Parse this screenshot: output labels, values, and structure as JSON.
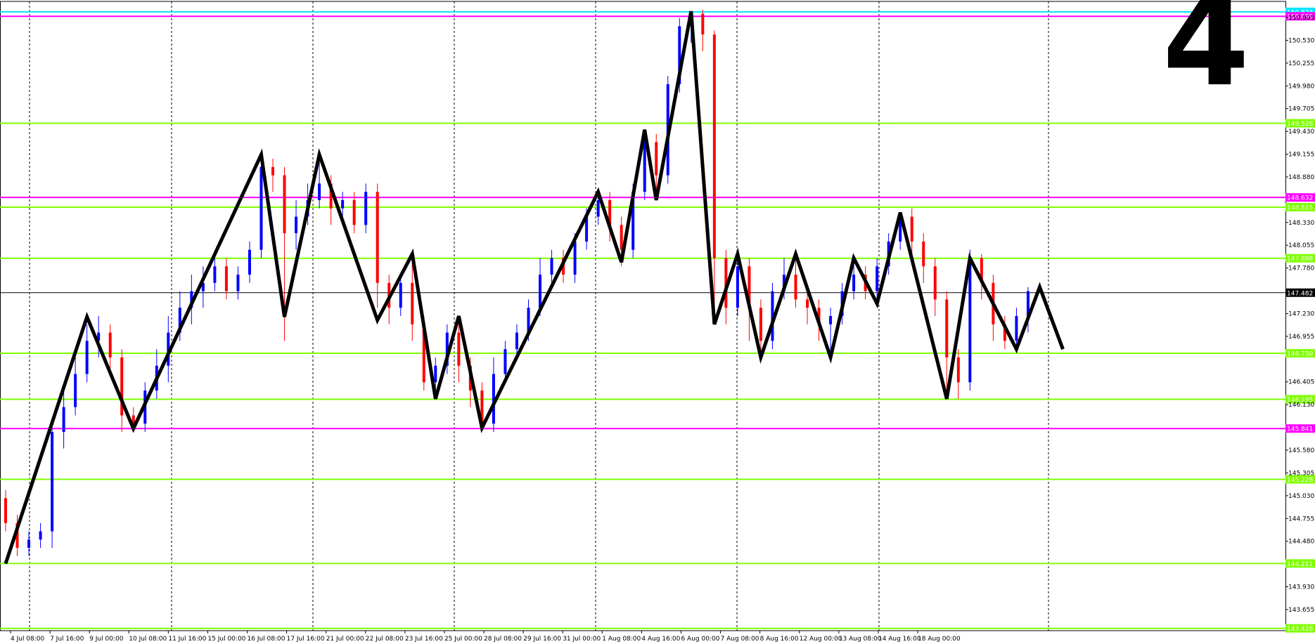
{
  "chart_data": {
    "type": "candlestick",
    "corner_label": "4",
    "ylim": [
      143.4,
      151.0
    ],
    "y_ticks": [
      "150.805",
      "150.530",
      "150.255",
      "149.980",
      "149.705",
      "149.430",
      "149.155",
      "148.880",
      "148.330",
      "148.055",
      "147.780",
      "147.230",
      "146.955",
      "146.405",
      "146.130",
      "145.580",
      "145.305",
      "145.030",
      "144.755",
      "144.480",
      "143.930",
      "143.655"
    ],
    "x_labels": [
      "4 Jul 08:00",
      "7 Jul 16:00",
      "9 Jul 00:00",
      "10 Jul 08:00",
      "11 Jul 16:00",
      "15 Jul 00:00",
      "16 Jul 08:00",
      "17 Jul 16:00",
      "21 Jul 00:00",
      "22 Jul 08:00",
      "23 Jul 16:00",
      "25 Jul 00:00",
      "28 Jul 08:00",
      "29 Jul 16:00",
      "31 Jul 00:00",
      "1 Aug 08:00",
      "4 Aug 16:00",
      "6 Aug 00:00",
      "7 Aug 08:00",
      "8 Aug 16:00",
      "12 Aug 00:00",
      "13 Aug 08:00",
      "14 Aug 16:00",
      "18 Aug 00:00"
    ],
    "horizontal_levels": [
      {
        "price": "150.874",
        "value": 150.874,
        "color": "#00e5ff"
      },
      {
        "price": "150.899",
        "value": 150.82,
        "color": "#ff00ff"
      },
      {
        "price": "149.528",
        "value": 149.528,
        "color": "#7fff00"
      },
      {
        "price": "148.632",
        "value": 148.632,
        "color": "#ff00ff"
      },
      {
        "price": "148.515",
        "value": 148.515,
        "color": "#7fff00"
      },
      {
        "price": "147.898",
        "value": 147.898,
        "color": "#7fff00"
      },
      {
        "price": "147.482",
        "value": 147.482,
        "color": "#000000"
      },
      {
        "price": "146.750",
        "value": 146.75,
        "color": "#7fff00"
      },
      {
        "price": "146.195",
        "value": 146.195,
        "color": "#7fff00"
      },
      {
        "price": "145.841",
        "value": 145.841,
        "color": "#ff00ff"
      },
      {
        "price": "145.228",
        "value": 145.228,
        "color": "#7fff00"
      },
      {
        "price": "144.211",
        "value": 144.211,
        "color": "#7fff00"
      },
      {
        "price": "143.428",
        "value": 143.428,
        "color": "#7fff00"
      }
    ],
    "bull_color": "#0000ff",
    "bear_color": "#ff0000",
    "zigzag_color": "#000000",
    "zigzag": [
      [
        0,
        144.21
      ],
      [
        7,
        147.19
      ],
      [
        11,
        145.84
      ],
      [
        22,
        149.15
      ],
      [
        24,
        147.19
      ],
      [
        27,
        149.15
      ],
      [
        32,
        147.15
      ],
      [
        35,
        147.95
      ],
      [
        37,
        146.2
      ],
      [
        39,
        147.2
      ],
      [
        41,
        145.85
      ],
      [
        51,
        148.7
      ],
      [
        53,
        147.85
      ],
      [
        55,
        149.45
      ],
      [
        56,
        148.6
      ],
      [
        59,
        150.88
      ],
      [
        61,
        147.1
      ],
      [
        63,
        147.95
      ],
      [
        65,
        146.7
      ],
      [
        68,
        147.95
      ],
      [
        71,
        146.7
      ],
      [
        73,
        147.9
      ],
      [
        75,
        147.35
      ],
      [
        77,
        148.45
      ],
      [
        81,
        146.2
      ],
      [
        83,
        147.9
      ],
      [
        87,
        146.8
      ],
      [
        89,
        147.55
      ],
      [
        91,
        146.8
      ]
    ],
    "candles": [
      [
        145.0,
        144.7,
        145.1,
        144.6
      ],
      [
        144.7,
        144.4,
        144.8,
        144.3
      ],
      [
        144.4,
        144.5,
        144.6,
        144.3
      ],
      [
        144.5,
        144.6,
        144.7,
        144.4
      ],
      [
        144.6,
        145.8,
        145.9,
        144.4
      ],
      [
        145.8,
        146.1,
        146.3,
        145.6
      ],
      [
        146.1,
        146.5,
        146.7,
        146.0
      ],
      [
        146.5,
        146.9,
        147.1,
        146.4
      ],
      [
        146.9,
        147.0,
        147.2,
        146.7
      ],
      [
        147.0,
        146.7,
        147.1,
        146.5
      ],
      [
        146.7,
        146.0,
        146.8,
        145.8
      ],
      [
        146.0,
        145.9,
        146.1,
        145.8
      ],
      [
        145.9,
        146.3,
        146.4,
        145.8
      ],
      [
        146.3,
        146.6,
        146.8,
        146.2
      ],
      [
        146.6,
        147.0,
        147.2,
        146.4
      ],
      [
        147.0,
        147.3,
        147.5,
        146.9
      ],
      [
        147.3,
        147.5,
        147.7,
        147.1
      ],
      [
        147.5,
        147.6,
        147.8,
        147.3
      ],
      [
        147.6,
        147.8,
        147.9,
        147.5
      ],
      [
        147.8,
        147.5,
        147.9,
        147.4
      ],
      [
        147.5,
        147.7,
        147.8,
        147.4
      ],
      [
        147.7,
        148.0,
        148.1,
        147.6
      ],
      [
        148.0,
        149.0,
        149.15,
        147.9
      ],
      [
        149.0,
        148.9,
        149.1,
        148.7
      ],
      [
        148.9,
        148.2,
        149.0,
        146.9
      ],
      [
        148.2,
        148.4,
        148.6,
        148.0
      ],
      [
        148.4,
        148.6,
        148.8,
        148.3
      ],
      [
        148.6,
        148.8,
        149.15,
        148.5
      ],
      [
        148.8,
        148.5,
        148.9,
        148.3
      ],
      [
        148.5,
        148.6,
        148.7,
        148.3
      ],
      [
        148.6,
        148.3,
        148.7,
        148.2
      ],
      [
        148.3,
        148.7,
        148.8,
        148.2
      ],
      [
        148.7,
        147.6,
        148.8,
        147.3
      ],
      [
        147.6,
        147.3,
        147.7,
        147.1
      ],
      [
        147.3,
        147.6,
        147.7,
        147.2
      ],
      [
        147.6,
        147.1,
        147.9,
        146.9
      ],
      [
        147.1,
        146.4,
        147.2,
        146.3
      ],
      [
        146.4,
        146.6,
        146.7,
        146.2
      ],
      [
        146.6,
        147.0,
        147.1,
        146.5
      ],
      [
        147.0,
        146.6,
        147.1,
        146.4
      ],
      [
        146.6,
        146.3,
        146.7,
        146.1
      ],
      [
        146.3,
        145.9,
        146.4,
        145.85
      ],
      [
        145.9,
        146.5,
        146.7,
        145.8
      ],
      [
        146.5,
        146.8,
        146.9,
        146.4
      ],
      [
        146.8,
        147.0,
        147.1,
        146.7
      ],
      [
        147.0,
        147.3,
        147.4,
        146.9
      ],
      [
        147.3,
        147.7,
        147.9,
        147.2
      ],
      [
        147.7,
        147.9,
        148.0,
        147.6
      ],
      [
        147.9,
        147.7,
        148.0,
        147.6
      ],
      [
        147.7,
        148.1,
        148.2,
        147.6
      ],
      [
        148.1,
        148.4,
        148.5,
        148.0
      ],
      [
        148.4,
        148.6,
        148.7,
        148.3
      ],
      [
        148.6,
        148.3,
        148.7,
        148.1
      ],
      [
        148.3,
        148.0,
        148.4,
        147.8
      ],
      [
        148.0,
        148.7,
        148.8,
        147.9
      ],
      [
        148.7,
        149.3,
        149.45,
        148.6
      ],
      [
        149.3,
        148.9,
        149.4,
        148.6
      ],
      [
        148.9,
        150.0,
        150.1,
        148.8
      ],
      [
        150.0,
        150.7,
        150.8,
        149.9
      ],
      [
        150.7,
        150.85,
        150.88,
        150.5
      ],
      [
        150.85,
        150.6,
        150.9,
        150.4
      ],
      [
        150.6,
        147.9,
        150.65,
        147.1
      ],
      [
        147.9,
        147.3,
        148.0,
        147.1
      ],
      [
        147.3,
        147.8,
        147.95,
        147.2
      ],
      [
        147.8,
        147.3,
        147.9,
        146.9
      ],
      [
        147.3,
        146.9,
        147.4,
        146.7
      ],
      [
        146.9,
        147.5,
        147.6,
        146.8
      ],
      [
        147.5,
        147.7,
        147.9,
        147.4
      ],
      [
        147.7,
        147.4,
        147.95,
        147.3
      ],
      [
        147.4,
        147.3,
        147.5,
        147.1
      ],
      [
        147.3,
        147.1,
        147.4,
        146.9
      ],
      [
        147.1,
        147.2,
        147.3,
        146.7
      ],
      [
        147.2,
        147.5,
        147.6,
        147.1
      ],
      [
        147.5,
        147.7,
        147.9,
        147.4
      ],
      [
        147.7,
        147.5,
        147.8,
        147.4
      ],
      [
        147.5,
        147.8,
        147.9,
        147.4
      ],
      [
        147.8,
        148.1,
        148.2,
        147.7
      ],
      [
        148.1,
        148.4,
        148.45,
        148.0
      ],
      [
        148.4,
        148.1,
        148.5,
        147.9
      ],
      [
        148.1,
        147.8,
        148.2,
        147.6
      ],
      [
        147.8,
        147.4,
        147.9,
        147.2
      ],
      [
        147.4,
        146.7,
        147.5,
        146.2
      ],
      [
        146.7,
        146.4,
        146.8,
        146.2
      ],
      [
        146.4,
        147.9,
        148.0,
        146.3
      ],
      [
        147.9,
        147.6,
        147.95,
        147.4
      ],
      [
        147.6,
        147.1,
        147.7,
        146.9
      ],
      [
        147.1,
        146.9,
        147.2,
        146.8
      ],
      [
        146.9,
        147.2,
        147.3,
        146.8
      ],
      [
        147.2,
        147.5,
        147.55,
        147.0
      ]
    ]
  }
}
